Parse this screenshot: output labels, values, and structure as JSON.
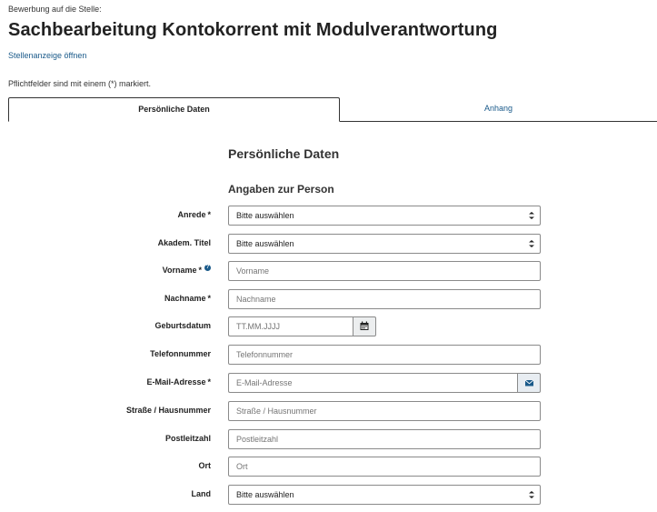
{
  "header": {
    "application_for": "Bewerbung auf die Stelle:",
    "job_title": "Sachbearbeitung Kontokorrent mit Modulverantwortung",
    "open_ad_link": "Stellenanzeige öffnen",
    "mandatory_note": "Pflichtfelder sind mit einem (*) markiert."
  },
  "tabs": [
    {
      "label": "Persönliche Daten",
      "active": true
    },
    {
      "label": "Anhang",
      "active": false
    }
  ],
  "form": {
    "section_title": "Persönliche Daten",
    "subsection_title": "Angaben zur Person",
    "fields": {
      "anrede": {
        "label": "Anrede",
        "required": "*",
        "value": "Bitte auswählen"
      },
      "titel": {
        "label": "Akadem. Titel",
        "value": "Bitte auswählen"
      },
      "vorname": {
        "label": "Vorname",
        "required": "*",
        "help": "?",
        "placeholder": "Vorname"
      },
      "nachname": {
        "label": "Nachname",
        "required": "*",
        "placeholder": "Nachname"
      },
      "geburtsdatum": {
        "label": "Geburtsdatum",
        "placeholder": "TT.MM.JJJJ"
      },
      "telefon": {
        "label": "Telefonnummer",
        "placeholder": "Telefonnummer"
      },
      "email": {
        "label": "E-Mail-Adresse",
        "required": "*",
        "placeholder": "E-Mail-Adresse"
      },
      "strasse": {
        "label": "Straße / Hausnummer",
        "placeholder": "Straße / Hausnummer"
      },
      "plz": {
        "label": "Postleitzahl",
        "placeholder": "Postleitzahl"
      },
      "ort": {
        "label": "Ort",
        "placeholder": "Ort"
      },
      "land": {
        "label": "Land",
        "value": "Bitte auswählen"
      }
    }
  },
  "colors": {
    "link": "#1a5a8a",
    "border": "#8a8a8a",
    "text": "#222222"
  },
  "icons": {
    "date_button": "calendar-icon",
    "email_button": "envelope-icon",
    "help": "question-circle-icon"
  }
}
